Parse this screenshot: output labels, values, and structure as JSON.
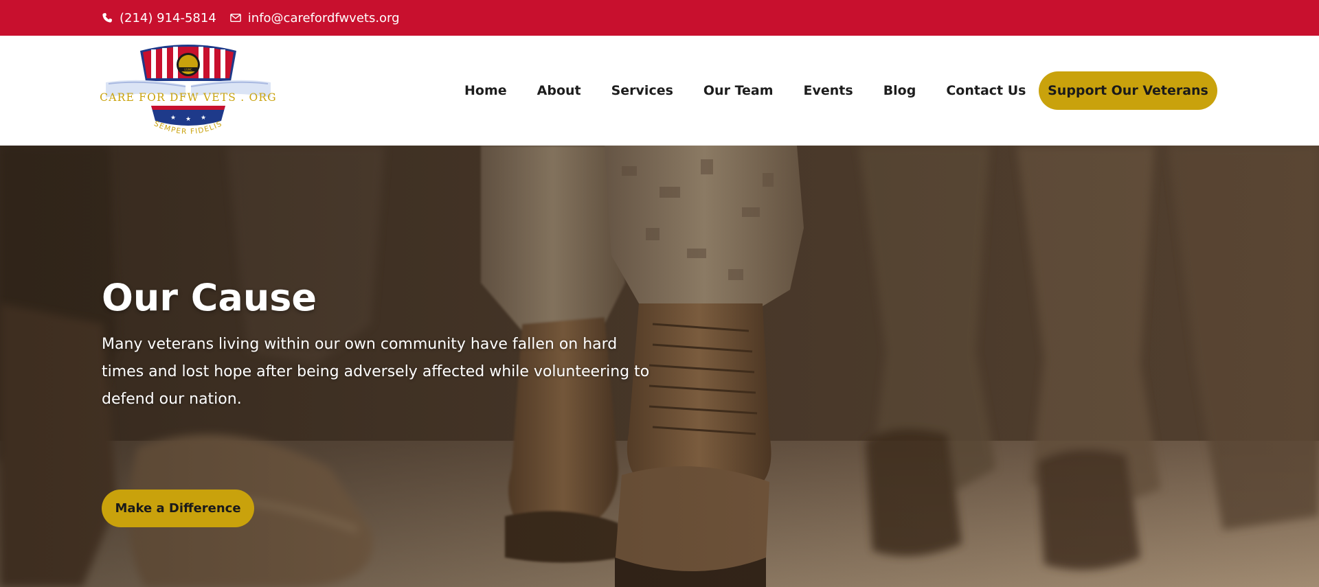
{
  "topbar": {
    "phone": "(214) 914-5814",
    "email": "info@carefordfwvets.org",
    "phone_icon": "phone-icon",
    "email_icon": "envelope-icon",
    "background": "#c8102e"
  },
  "logo": {
    "name": "CARE FOR DFW VETS . ORG",
    "motto": "SEMPER FIDELIS",
    "badge_text": "USMC"
  },
  "nav": {
    "items": [
      "Home",
      "About",
      "Services",
      "Our Team",
      "Events",
      "Blog",
      "Contact Us"
    ]
  },
  "header": {
    "support_label": "Support Our Veterans"
  },
  "hero": {
    "title": "Our Cause",
    "text": "Many veterans living within our own community have fallen on hard times and lost hope after being adversely affected while volunteering to defend our nation.",
    "cta_label": "Make a Difference"
  },
  "colors": {
    "accent": "#c9a20c",
    "brand_red": "#c8102e",
    "brand_blue": "#1e3a8a"
  }
}
